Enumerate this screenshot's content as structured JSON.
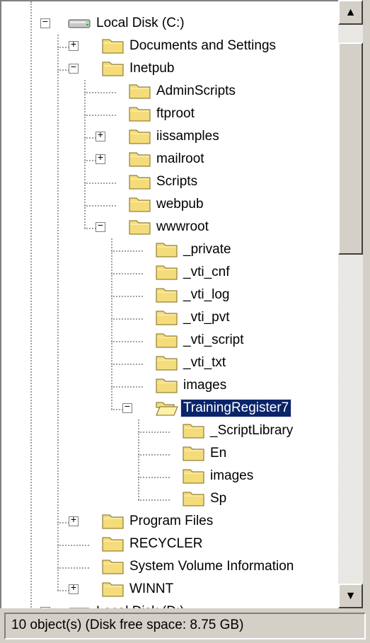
{
  "tree": {
    "items": [
      {
        "label": "Local Disk (C:)",
        "icon": "drive-icon",
        "expander": "minus"
      },
      {
        "label": "Documents and Settings",
        "icon": "folder-icon",
        "expander": "plus"
      },
      {
        "label": "Inetpub",
        "icon": "folder-icon",
        "expander": "minus"
      },
      {
        "label": "AdminScripts",
        "icon": "folder-icon",
        "expander": ""
      },
      {
        "label": "ftproot",
        "icon": "folder-icon",
        "expander": ""
      },
      {
        "label": "iissamples",
        "icon": "folder-icon",
        "expander": "plus"
      },
      {
        "label": "mailroot",
        "icon": "folder-icon",
        "expander": "plus"
      },
      {
        "label": "Scripts",
        "icon": "folder-icon",
        "expander": ""
      },
      {
        "label": "webpub",
        "icon": "folder-icon",
        "expander": ""
      },
      {
        "label": "wwwroot",
        "icon": "folder-icon",
        "expander": "minus"
      },
      {
        "label": "_private",
        "icon": "folder-icon",
        "expander": ""
      },
      {
        "label": "_vti_cnf",
        "icon": "folder-icon",
        "expander": ""
      },
      {
        "label": "_vti_log",
        "icon": "folder-icon",
        "expander": ""
      },
      {
        "label": "_vti_pvt",
        "icon": "folder-icon",
        "expander": ""
      },
      {
        "label": "_vti_script",
        "icon": "folder-icon",
        "expander": ""
      },
      {
        "label": "_vti_txt",
        "icon": "folder-icon",
        "expander": ""
      },
      {
        "label": "images",
        "icon": "folder-icon",
        "expander": ""
      },
      {
        "label": "TrainingRegister7",
        "icon": "open-folder-icon",
        "expander": "minus",
        "selected": true
      },
      {
        "label": "_ScriptLibrary",
        "icon": "folder-icon",
        "expander": ""
      },
      {
        "label": "En",
        "icon": "folder-icon",
        "expander": ""
      },
      {
        "label": "images",
        "icon": "folder-icon",
        "expander": ""
      },
      {
        "label": "Sp",
        "icon": "folder-icon",
        "expander": ""
      },
      {
        "label": "Program Files",
        "icon": "folder-icon",
        "expander": "plus"
      },
      {
        "label": "RECYCLER",
        "icon": "folder-icon",
        "expander": ""
      },
      {
        "label": "System Volume Information",
        "icon": "folder-icon",
        "expander": ""
      },
      {
        "label": "WINNT",
        "icon": "folder-icon",
        "expander": "plus"
      },
      {
        "label": "Local Disk (D:)",
        "icon": "drive-icon",
        "expander": "minus"
      }
    ]
  },
  "scrollbar": {
    "up_arrow": "▲",
    "down_arrow": "▼"
  },
  "status": {
    "text": "10 object(s) (Disk free space: 8.75 GB)"
  },
  "colors": {
    "selection": "#0a246a",
    "folder": "#f5dc7a",
    "window": "#d4d0c8"
  }
}
